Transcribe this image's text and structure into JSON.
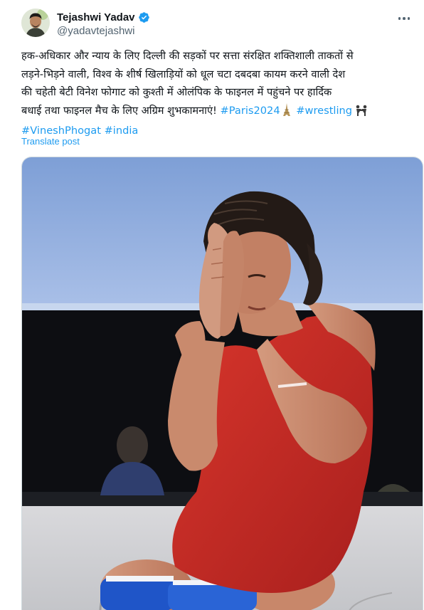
{
  "post": {
    "author": {
      "display_name": "Tejashwi Yadav",
      "handle": "@yadavtejashwi",
      "verified": true,
      "verified_color": "#1d9bf0"
    },
    "more_icon": "more-horizontal-icon",
    "text": {
      "line1": "हक-अधिकार और न्याय के लिए दिल्ली की सड़कों पर सत्ता संरक्षित शक्तिशाली ताकतों से",
      "line2": "लड़ने-भिड़ने वाली, विश्व के शीर्ष खिलाड़ियों को धूल चटा दबदबा कायम करने वाली देश",
      "line3": "की चहेती बेटी विनेश फोगाट को कुश्ती में ओलंपिक के फाइनल में पहुंचने पर हार्दिक",
      "line4": "बधाई तथा फाइनल मैच के लिए अग्रिम शुभकामनाएं!",
      "hashtags": [
        "#Paris2024",
        "#wrestling",
        "#VineshPhogat",
        "#india"
      ],
      "emojis": [
        "eiffel-tower-emoji",
        "wrestlers-emoji"
      ]
    },
    "translate_label": "Translate post",
    "link_color": "#1d9bf0",
    "media": {
      "type": "photo",
      "subject": "wrestler-in-red-singlet"
    }
  }
}
